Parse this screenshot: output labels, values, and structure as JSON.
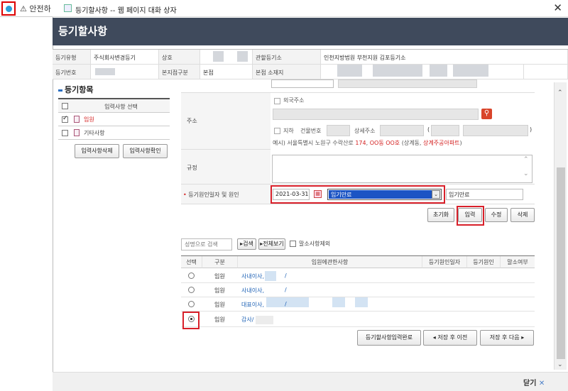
{
  "background": {
    "warning_text": "안전하"
  },
  "dialog": {
    "window_title": "등기할사항 -- 웹 페이지 대화 상자",
    "header_title": "등기할사항"
  },
  "info": {
    "type_label": "등기유형",
    "type_value": "주식회사변경등기",
    "name_label": "상호",
    "court_label": "관할등기소",
    "court_value": "인천지방법원 부천지원 김포등기소",
    "regno_label": "등기번호",
    "branch_label": "본지점구분",
    "branch_value": "본점",
    "addr_label": "본점 소재지"
  },
  "left_panel": {
    "section_title": "등기항목",
    "table_header": "입력사항 선택",
    "items": [
      {
        "label": "임원",
        "checked": true
      },
      {
        "label": "기타사항",
        "checked": false
      }
    ],
    "delete_button": "입력사항삭제",
    "confirm_button": "입력사항확인"
  },
  "form": {
    "address_label": "주소",
    "foreign_address": "외국주소",
    "basement": "지하",
    "building_no": "건물번호",
    "detail_address": "상세주소",
    "paren_open": "(",
    "paren_close": ")",
    "example_prefix": "예시) 서울특별시 노원구 수락산로 ",
    "example_red1": "174",
    "example_mid": ", ",
    "example_red2": "OO동 OO호",
    "example_mid2": " (상계동, ",
    "example_red3": "상계주공아파트",
    "example_end": ")",
    "rule_label": "규정",
    "date_reason_label": "등기원인일자 및 원인",
    "required_mark": "•",
    "date_value": "2021-03-31",
    "reason_selected": "임기만료",
    "reason_text": "임기만료",
    "reset_button": "초기화",
    "input_button": "입력",
    "edit_button": "수정",
    "delete_button": "삭제"
  },
  "search": {
    "placeholder": "성명으로 검색",
    "search_button": "▸검색",
    "view_all_button": "▸전체보기",
    "exclude_label": "말소사항제외"
  },
  "list": {
    "columns": [
      "선택",
      "구분",
      "임원에관한사항",
      "등기원인일자",
      "등기원인",
      "말소여부"
    ],
    "rows": [
      {
        "kind": "임원",
        "desc": "사내이사,",
        "slash": "/",
        "selected": false
      },
      {
        "kind": "임원",
        "desc": "사내이사,",
        "slash": "/",
        "selected": false
      },
      {
        "kind": "임원",
        "desc": "대표이사,",
        "slash": "/",
        "selected": false
      },
      {
        "kind": "임원",
        "desc": "감사/",
        "slash": "",
        "selected": true
      }
    ]
  },
  "bottom": {
    "complete_button": "등기할사항입력완료",
    "save_prev_button": "저장 후 이전",
    "save_next_button": "저장 후 다음"
  },
  "footer": {
    "close_label": "닫기"
  }
}
